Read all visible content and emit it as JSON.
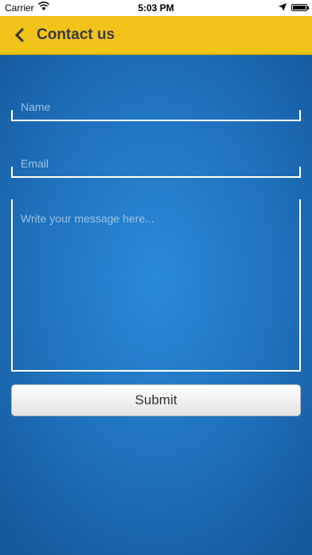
{
  "status_bar": {
    "carrier": "Carrier",
    "time": "5:03 PM"
  },
  "nav": {
    "title": "Contact us"
  },
  "form": {
    "name_placeholder": "Name",
    "email_placeholder": "Email",
    "message_placeholder": "Write your message here...",
    "submit_label": "Submit"
  },
  "colors": {
    "nav_background": "#f2c419",
    "page_background": "#1f72bd",
    "field_border": "#ffffff"
  }
}
